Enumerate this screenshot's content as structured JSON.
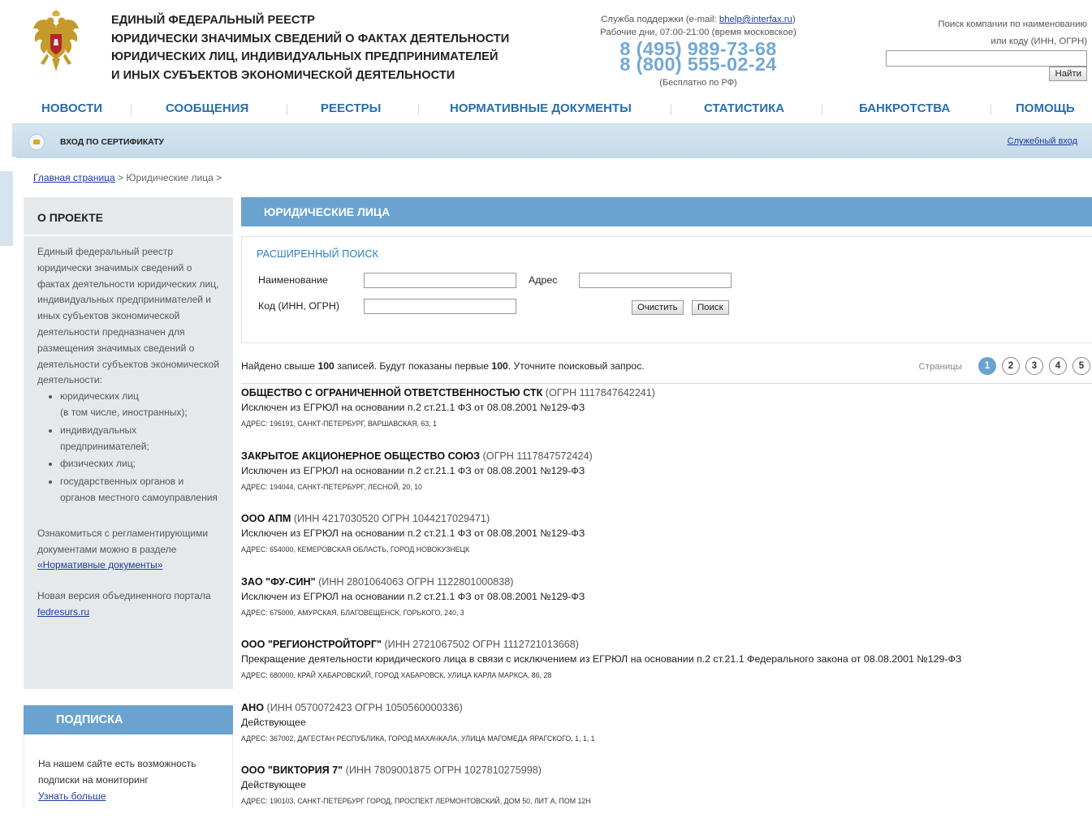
{
  "header": {
    "title_lines": [
      "ЕДИНЫЙ ФЕДЕРАЛЬНЫЙ РЕЕСТР",
      "ЮРИДИЧЕСКИ ЗНАЧИМЫХ СВЕДЕНИЙ О ФАКТАХ ДЕЯТЕЛЬНОСТИ",
      "ЮРИДИЧЕСКИХ ЛИЦ, ИНДИВИДУАЛЬНЫХ ПРЕДПРИНИМАТЕЛЕЙ",
      "И ИНЫХ СУБЪЕКТОВ ЭКОНОМИЧЕСКОЙ ДЕЯТЕЛЬНОСТИ"
    ],
    "emblem_icon": "russian-coat-of-arms",
    "support": {
      "line1_prefix": "Служба поддержки (e-mail: ",
      "email": "bhelp@interfax.ru",
      "line1_suffix": ")",
      "hours": "Рабочие дни, 07:00-21:00 (время московское)",
      "phone1": "8 (495) 989-73-68",
      "phone2": "8 (800) 555-02-24",
      "free_note": "(Бесплатно по РФ)"
    },
    "company_search": {
      "label_line1": "Поиск компании по наименованию",
      "label_line2": "или коду (ИНН, ОГРН)",
      "value": "",
      "button": "Найти"
    }
  },
  "nav": [
    "НОВОСТИ",
    "СООБЩЕНИЯ",
    "РЕЕСТРЫ",
    "НОРМАТИВНЫЕ ДОКУМЕНТЫ",
    "СТАТИСТИКА",
    "БАНКРОТСТВА",
    "ПОМОЩЬ"
  ],
  "certbar": {
    "label": "ВХОД ПО СЕРТИФИКАТУ",
    "service_login": "Служебный вход",
    "icon": "lock-icon"
  },
  "breadcrumb": {
    "home": "Главная страница",
    "sep1": " > ",
    "current": "Юридические лица",
    "sep2": " >"
  },
  "about": {
    "title": "О ПРОЕКТЕ",
    "intro": "Единый федеральный реестр юридически значимых сведений о фактах деятельности юридических лиц, индивидуальных предпринимателей и иных субъектов экономической деятельности предназначен для размещения значимых сведений о деятельности субъектов экономической деятельности:",
    "items": [
      {
        "line1": "юридических лиц",
        "line2": "(в том числе, иностранных);"
      },
      {
        "line1": "индивидуальных",
        "line2": "предпринимателей;"
      },
      {
        "line1": "физических лиц;",
        "line2": ""
      },
      {
        "line1": "государственных органов и",
        "line2": "органов местного самоуправления"
      }
    ],
    "docs_text": "Ознакомиться с регламентирующими документами можно в разделе ",
    "docs_link": "«Нормативные документы»",
    "new_version_text": "Новая версия объединенного портала ",
    "new_version_link": "fedresurs.ru"
  },
  "subscription": {
    "title": "ПОДПИСКА",
    "text": "На нашем сайте есть возможность подписки на мониторинг",
    "link": "Узнать больше"
  },
  "main": {
    "section_title": "ЮРИДИЧЕСКИЕ ЛИЦА",
    "adv_search": {
      "title": "РАСШИРЕННЫЙ ПОИСК",
      "name_label": "Наименование",
      "name_value": "",
      "address_label": "Адрес",
      "address_value": "",
      "code_label": "Код (ИНН, ОГРН)",
      "code_value": "",
      "clear_button": "Очистить",
      "search_button": "Поиск"
    },
    "results_info": {
      "part1": "Найдено свыше ",
      "count1": "100",
      "part2": " записей. Будут показаны первые ",
      "count2": "100",
      "part3": ". Уточните поисковый запрос."
    },
    "pagination": {
      "label": "Страницы",
      "pages": [
        "1",
        "2",
        "3",
        "4",
        "5"
      ],
      "active": "1"
    },
    "results": [
      {
        "name": "ОБЩЕСТВО С ОГРАНИЧЕННОЙ ОТВЕТСТВЕННОСТЬЮ СТК",
        "codes": " (ОГРН 1117847642241)",
        "status": "Исключен из ЕГРЮЛ на основании п.2 ст.21.1 ФЗ от 08.08.2001 №129-ФЗ",
        "address": "Адрес: 196191, САНКТ-ПЕТЕРБУРГ, ВАРШАВСКАЯ, 63, 1"
      },
      {
        "name": "ЗАКРЫТОЕ АКЦИОНЕРНОЕ ОБЩЕСТВО СОЮЗ",
        "codes": " (ОГРН 1117847572424)",
        "status": "Исключен из ЕГРЮЛ на основании п.2 ст.21.1 ФЗ от 08.08.2001 №129-ФЗ",
        "address": "Адрес: 194044, САНКТ-ПЕТЕРБУРГ, ЛЕСНОЙ, 20, 10"
      },
      {
        "name": "ООО АПМ",
        "codes": " (ИНН 4217030520 ОГРН 1044217029471)",
        "status": "Исключен из ЕГРЮЛ на основании п.2 ст.21.1 ФЗ от 08.08.2001 №129-ФЗ",
        "address": "Адрес: 654000, КЕМЕРОВСКАЯ ОБЛАСТЬ, ГОРОД НОВОКУЗНЕЦК"
      },
      {
        "name": "ЗАО \"ФУ-СИН\"",
        "codes": " (ИНН 2801064063 ОГРН 1122801000838)",
        "status": "Исключен из ЕГРЮЛ на основании п.2 ст.21.1 ФЗ от 08.08.2001 №129-ФЗ",
        "address": "Адрес: 675000, АМУРСКАЯ, БЛАГОВЕЩЕНСК, ГОРЬКОГО, 240, 3"
      },
      {
        "name": "ООО \"РЕГИОНСТРОЙТОРГ\"",
        "codes": " (ИНН 2721067502 ОГРН 1112721013668)",
        "status": "Прекращение деятельности юридического лица в связи с исключением из ЕГРЮЛ на основании п.2 ст.21.1 Федерального закона от 08.08.2001 №129-ФЗ",
        "address": "Адрес: 680000, КРАЙ ХАБАРОВСКИЙ, ГОРОД ХАБАРОВСК, УЛИЦА КАРЛА МАРКСА, 86, 28"
      },
      {
        "name": "АНО",
        "codes": " (ИНН 0570072423 ОГРН 1050560000336)",
        "status": "Действующее",
        "address": "Адрес: 367002, ДАГЕСТАН РЕСПУБЛИКА, ГОРОД МАХАЧКАЛА, УЛИЦА МАГОМЕДА ЯРАГСКОГО, 1, 1, 1"
      },
      {
        "name": "ООО \"ВИКТОРИЯ 7\"",
        "codes": " (ИНН 7809001875 ОГРН 1027810275998)",
        "status": "Действующее",
        "address": "Адрес: 190103, САНКТ-ПЕТЕРБУРГ ГОРОД, ПРОСПЕКТ ЛЕРМОНТОВСКИЙ, ДОМ 50, ЛИТ А, ПОМ 12Н"
      }
    ]
  },
  "colors": {
    "accent_blue": "#6aa3cf",
    "nav_text": "#2a6fab",
    "phone": "#74a8d2",
    "link": "#1a3c9e"
  }
}
